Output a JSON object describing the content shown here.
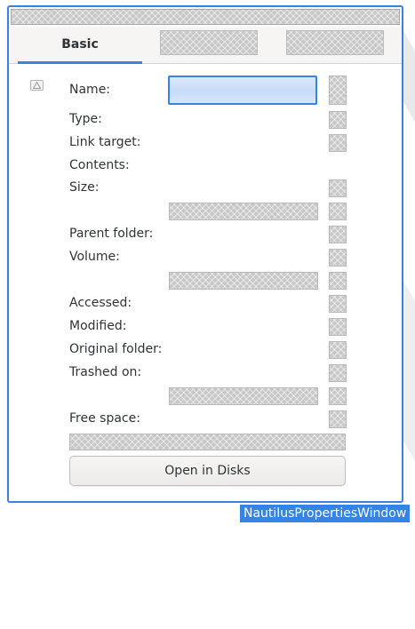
{
  "window": {
    "tag": "NautilusPropertiesWindow"
  },
  "tabs": [
    {
      "label": "Basic",
      "active": true
    }
  ],
  "fields": {
    "name": "Name:",
    "type": "Type:",
    "link_target": "Link target:",
    "contents": "Contents:",
    "size": "Size:",
    "parent_folder": "Parent folder:",
    "volume": "Volume:",
    "accessed": "Accessed:",
    "modified": "Modified:",
    "original_folder": "Original folder:",
    "trashed_on": "Trashed on:",
    "free_space": "Free space:"
  },
  "name_input": {
    "value": ""
  },
  "buttons": {
    "open_in_disks": "Open in Disks"
  },
  "colors": {
    "accent": "#3584e4",
    "background": "#ffffff",
    "tab_bar": "#f6f5f4",
    "text": "#2e3436"
  }
}
